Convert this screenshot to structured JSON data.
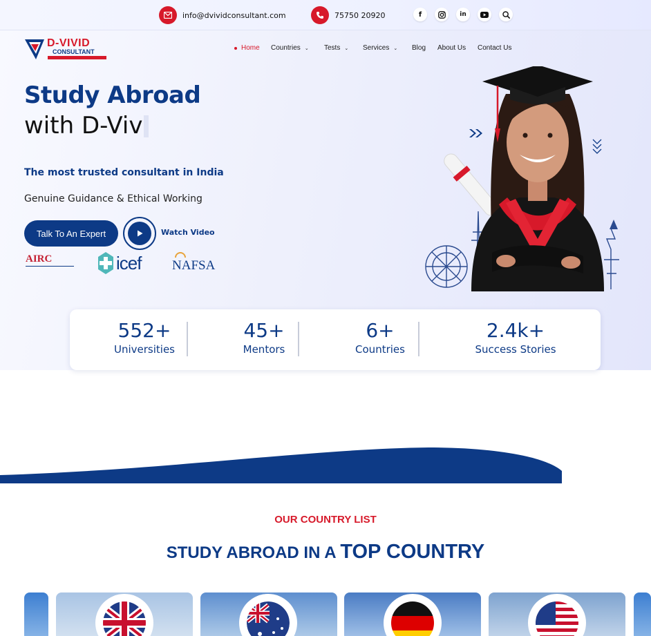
{
  "topbar": {
    "email": "info@dvividconsultant.com",
    "phone": "75750 20920",
    "social_icons": [
      "facebook-icon",
      "instagram-icon",
      "linkedin-icon",
      "youtube-icon",
      "search-icon"
    ]
  },
  "brand": {
    "logo_text": "D-VIVID",
    "logo_sub": "CONSULTANT",
    "accent": "#d7192a",
    "primary": "#0d3a86"
  },
  "nav": {
    "items": [
      {
        "label": "Home",
        "active": true
      },
      {
        "label": "Countries",
        "dropdown": true
      },
      {
        "label": "Tests",
        "dropdown": true
      },
      {
        "label": "Services",
        "dropdown": true
      },
      {
        "label": "Blog"
      },
      {
        "label": "About Us"
      },
      {
        "label": "Contact Us"
      }
    ]
  },
  "hero": {
    "title_line1": "Study Abroad",
    "title_line2": "with D-Viv",
    "tagline": "The most trusted consultant in India",
    "subtagline": "Genuine Guidance & Ethical Working",
    "cta_label": "Talk To An Expert",
    "video_label": "Watch Video",
    "accreditations": [
      "AIRC",
      "icef",
      "NAFSA"
    ]
  },
  "stats": [
    {
      "value": "552+",
      "label": "Universities"
    },
    {
      "value": "45+",
      "label": "Mentors"
    },
    {
      "value": "6+",
      "label": "Countries"
    },
    {
      "value": "2.4k+",
      "label": "Success Stories"
    }
  ],
  "countries_section": {
    "kicker": "OUR COUNTRY LIST",
    "title_plain": "STUDY ABROAD IN A ",
    "title_bold": "TOP COUNTRY",
    "flags": [
      "uk-flag-icon",
      "australia-flag-icon",
      "germany-flag-icon",
      "usa-flag-icon"
    ]
  }
}
